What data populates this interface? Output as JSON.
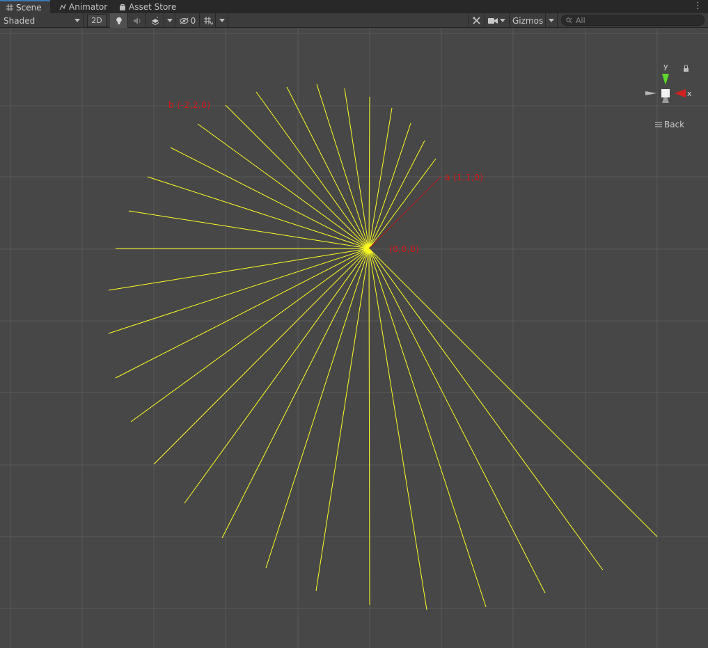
{
  "tabs": [
    {
      "label": "Scene",
      "icon": "grid-icon"
    },
    {
      "label": "Animator",
      "icon": "animator-icon"
    },
    {
      "label": "Asset Store",
      "icon": "bag-icon"
    }
  ],
  "toolbar": {
    "draw_mode": "Shaded",
    "mode_2d": "2D",
    "hidden_count": "0",
    "gizmos_label": "Gizmos",
    "search_placeholder": "All"
  },
  "scene_gizmo": {
    "y_axis": "y",
    "x_axis": "x",
    "back_label": "Back",
    "colors": {
      "y": "#5fd62b",
      "x": "#d32020"
    }
  },
  "labels": {
    "b": "b  (-2,2,0)",
    "a": "a  (1,1,0)",
    "origin": "(0,0,0)"
  },
  "colors": {
    "ray": "#ffff22",
    "vector_a": "#b81a1a",
    "label": "#e01414",
    "grid": "#5a5a5a"
  }
}
